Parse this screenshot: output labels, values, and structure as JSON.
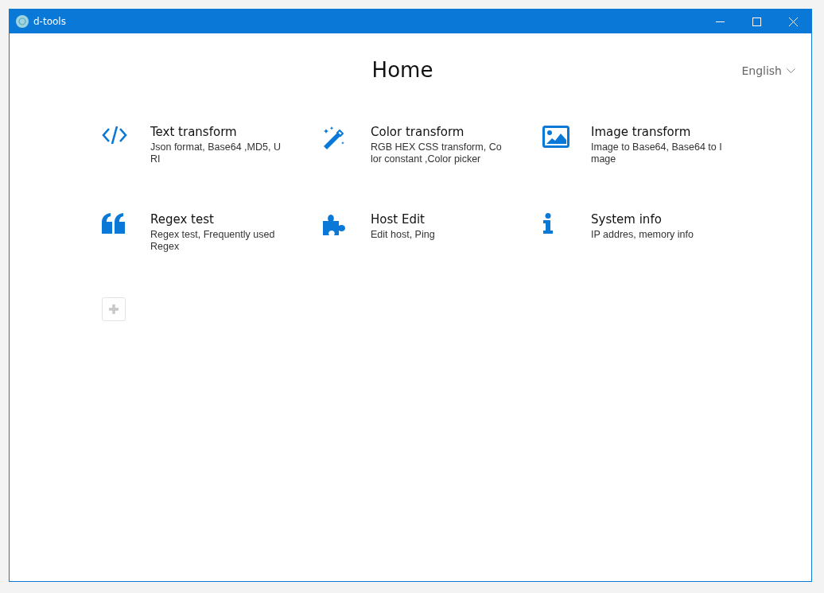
{
  "window": {
    "title": "d-tools"
  },
  "page": {
    "title": "Home",
    "language": "English"
  },
  "tools": [
    {
      "kind": "code",
      "title": "Text transform",
      "description": "Json format, Base64 ,MD5, URI"
    },
    {
      "kind": "wand",
      "title": "Color transform",
      "description": "RGB HEX CSS transform, Color constant ,Color picker"
    },
    {
      "kind": "image",
      "title": "Image transform",
      "description": "Image to Base64, Base64 to Image"
    },
    {
      "kind": "quote",
      "title": "Regex test",
      "description": "Regex test, Frequently used Regex"
    },
    {
      "kind": "puzzle",
      "title": "Host Edit",
      "description": "Edit host, Ping"
    },
    {
      "kind": "info",
      "title": "System info",
      "description": "IP addres, memory info"
    }
  ]
}
